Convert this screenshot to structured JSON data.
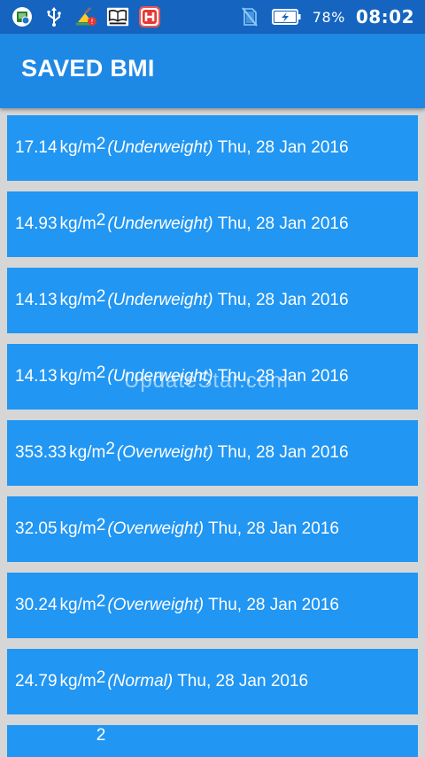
{
  "status_bar": {
    "icons": [
      "image-icon",
      "usb-icon",
      "broom-icon",
      "book-icon",
      "hotel-app-icon"
    ],
    "signal_icon": "no-sim-icon",
    "battery_icon": "battery-charging-icon",
    "battery_percent": "78%",
    "time": "08:02"
  },
  "app_bar": {
    "title": "SAVED BMI"
  },
  "bmi_list": [
    {
      "value": "17.14",
      "unit": "kg/m",
      "exponent": "2",
      "category": "(Underweight)",
      "date": "Thu, 28 Jan 2016"
    },
    {
      "value": "14.93",
      "unit": "kg/m",
      "exponent": "2",
      "category": "(Underweight)",
      "date": "Thu, 28 Jan 2016"
    },
    {
      "value": "14.13",
      "unit": "kg/m",
      "exponent": "2",
      "category": "(Underweight)",
      "date": "Thu, 28 Jan 2016"
    },
    {
      "value": "14.13",
      "unit": "kg/m",
      "exponent": "2",
      "category": "(Underweight)",
      "date": "Thu, 28 Jan 2016"
    },
    {
      "value": "353.33",
      "unit": "kg/m",
      "exponent": "2",
      "category": "(Overweight)",
      "date": "Thu, 28 Jan 2016"
    },
    {
      "value": "32.05",
      "unit": "kg/m",
      "exponent": "2",
      "category": "(Overweight)",
      "date": "Thu, 28 Jan 2016"
    },
    {
      "value": "30.24",
      "unit": "kg/m",
      "exponent": "2",
      "category": "(Overweight)",
      "date": "Thu, 28 Jan 2016"
    },
    {
      "value": "24.79",
      "unit": "kg/m",
      "exponent": "2",
      "category": "(Normal)",
      "date": "Thu, 28 Jan 2016"
    }
  ],
  "partial_item": {
    "exponent": "2"
  },
  "watermark": "UpdateStar.com",
  "colors": {
    "status_bar": "#1565c0",
    "app_bar": "#1e88e5",
    "list_item": "#2196f3",
    "divider": "#d6d6d6"
  }
}
